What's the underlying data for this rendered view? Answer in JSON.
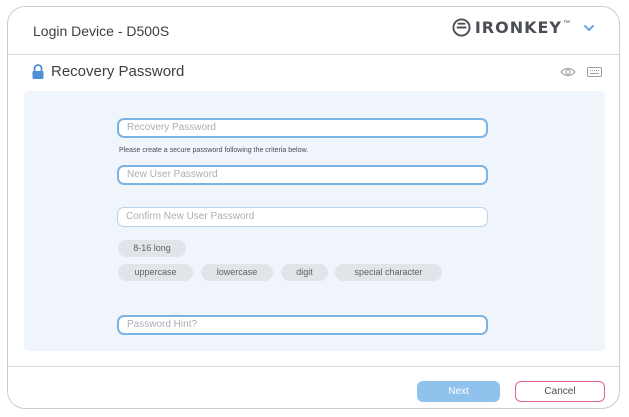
{
  "window": {
    "device_title": "Login Device - D500S",
    "brand": "IRONKEY",
    "brand_tm": "™"
  },
  "section": {
    "title": "Recovery Password"
  },
  "form": {
    "recovery_password": {
      "value": "",
      "placeholder": "Recovery Password"
    },
    "helper_text": "Please create a secure password following the criteria below.",
    "new_password": {
      "value": "",
      "placeholder": "New User Password"
    },
    "confirm_password": {
      "value": "",
      "placeholder": "Confirm New User Password"
    },
    "criteria": [
      "8-16 long",
      "uppercase",
      "lowercase",
      "digit",
      "special character"
    ],
    "password_hint": {
      "value": "",
      "placeholder": "Password Hint?"
    }
  },
  "actions": {
    "next_label": "Next",
    "cancel_label": "Cancel"
  },
  "colors": {
    "accent": "#7bb3e4",
    "panel_bg": "#eff5fb",
    "next_bg": "#8fc2ec",
    "cancel_border": "#e36481",
    "lock_icon": "#4f8fd6"
  },
  "icons": {
    "brand_logo": "ironkey-logo-icon",
    "menu": "chevron-down-icon",
    "section": "lock-icon",
    "show_password": "eye-icon",
    "virtual_keyboard": "keyboard-icon"
  }
}
